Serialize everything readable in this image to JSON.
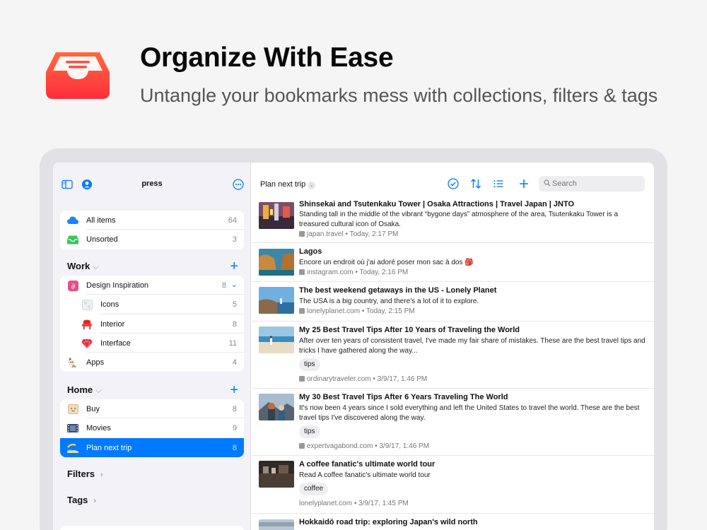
{
  "hero": {
    "title": "Organize With Ease",
    "subtitle": "Untangle your bookmarks mess with collections, filters & tags"
  },
  "colors": {
    "accent": "#007aff",
    "brand": "#ff3b30",
    "selected": "#007aff"
  },
  "sidebar": {
    "title": "press",
    "default_group": [
      {
        "label": "All items",
        "count": "64",
        "icon": "cloud-icon"
      },
      {
        "label": "Unsorted",
        "count": "3",
        "icon": "inbox-icon"
      }
    ],
    "work": {
      "label": "Work",
      "items": [
        {
          "label": "Design Inspiration",
          "count": "8",
          "icon": "dribbble-icon"
        },
        {
          "label": "Icons",
          "count": "5",
          "icon": "icons-icon"
        },
        {
          "label": "Interior",
          "count": "8",
          "icon": "chair-icon"
        },
        {
          "label": "Interface",
          "count": "11",
          "icon": "gem-icon"
        },
        {
          "label": "Apps",
          "count": "4",
          "icon": "cat-icon"
        }
      ]
    },
    "home": {
      "label": "Home",
      "items": [
        {
          "label": "Buy",
          "count": "8",
          "icon": "box-icon"
        },
        {
          "label": "Movies",
          "count": "9",
          "icon": "film-icon"
        },
        {
          "label": "Plan next trip",
          "count": "8",
          "icon": "beach-icon"
        }
      ]
    },
    "filters_label": "Filters",
    "tags_label": "Tags"
  },
  "toolbar": {
    "title": "Plan next trip",
    "search_placeholder": "Search"
  },
  "items": [
    {
      "title": "Shinsekai and Tsutenkaku Tower | Osaka Attractions | Travel Japan | JNTO",
      "excerpt": "Standing tall in the middle of the vibrant “bygone days” atmosphere of the area, Tsutenkaku Tower is a treasured cultural icon of Osaka.",
      "meta": "japan.travel • Today, 2:17 PM"
    },
    {
      "title": "Lagos",
      "excerpt": "Encore un endroit où j'ai adoré poser mon sac à dos 🎒",
      "meta": "instagram.com • Today, 2:16 PM"
    },
    {
      "title": "The best weekend getaways in the US - Lonely Planet",
      "excerpt": "The USA is a big country, and there’s a lot of it to explore.",
      "meta": "lonelyplanet.com • Today, 2:15 PM"
    },
    {
      "title": "My 25 Best Travel Tips After 10 Years of Traveling the World",
      "excerpt": "After over ten years of consistent travel, I've made my fair share of mistakes. These are the best travel tips and tricks I have gathered along the way...",
      "tag": "tips",
      "meta": "ordinarytraveler.com • 3/9/17, 1:46 PM"
    },
    {
      "title": "My 30 Best Travel Tips After 6 Years Traveling The World",
      "excerpt": "It's now been 4 years since I sold everything and left the United States to travel the world. These are the best travel tips I've discovered along the way.",
      "tag": "tips",
      "meta": "expertvagabond.com • 3/9/17, 1:46 PM"
    },
    {
      "title": "A coffee fanatic's ultimate world tour",
      "excerpt": "Read A coffee fanatic's ultimate world tour",
      "tag": "coffee",
      "meta": "lonelyplanet.com • 3/9/17, 1:45 PM"
    },
    {
      "title": "Hokkaidō road trip: exploring Japan's wild north"
    }
  ]
}
